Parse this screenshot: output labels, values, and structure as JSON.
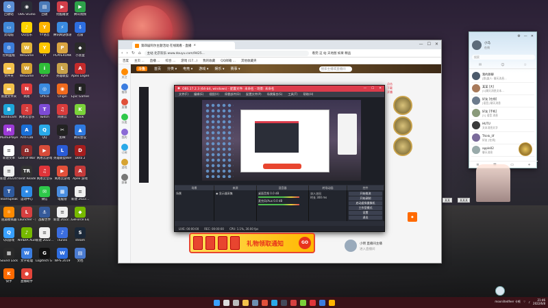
{
  "desktop": {
    "icons": [
      {
        "label": "回收站",
        "color": "#5b8fd6",
        "glyph": "♻"
      },
      {
        "label": "OBS Studio",
        "color": "#2b2e38",
        "glyph": "◉"
      },
      {
        "label": "回收",
        "color": "#4b7ab8",
        "glyph": "▤"
      },
      {
        "label": "优酷播放",
        "color": "#d23f4a",
        "glyph": "▶"
      },
      {
        "label": "腾讯视频",
        "color": "#2ea34a",
        "glyph": "▶"
      },
      {
        "label": "此电脑",
        "color": "#3f87d6",
        "glyph": "▭"
      },
      {
        "label": "QQ音乐",
        "color": "#ffd400",
        "glyph": "♪"
      },
      {
        "label": "YY语音",
        "color": "#ffb400",
        "glyph": "Y"
      },
      {
        "label": "腾讯网游加速",
        "color": "#3a8be0",
        "glyph": "⚡"
      },
      {
        "label": "迅雷",
        "color": "#2d6ee0",
        "glyph": "⇩"
      },
      {
        "label": "控制面板",
        "color": "#3c7dd9",
        "glyph": "⚙"
      },
      {
        "label": "WeGame",
        "color": "#e3b53a",
        "glyph": "W"
      },
      {
        "label": "YY",
        "color": "#ffc500",
        "glyph": "Y"
      },
      {
        "label": "PLAYERUNKNOWN'S BATTLEGR...",
        "color": "#d9a441",
        "glyph": "P"
      },
      {
        "label": "小黑盒",
        "color": "#2a2a2a",
        "glyph": "◆"
      },
      {
        "label": "文件夹",
        "color": "#f3c14b",
        "glyph": "▬"
      },
      {
        "label": "WeGame",
        "color": "#d6a332",
        "glyph": "W"
      },
      {
        "label": "iQIYI",
        "color": "#2fbd38",
        "glyph": "i"
      },
      {
        "label": "英雄联盟",
        "color": "#c9a24a",
        "glyph": "L"
      },
      {
        "label": "Apex Legends",
        "color": "#c52b2b",
        "glyph": "A"
      },
      {
        "label": "新建文件夹",
        "color": "#f3c14b",
        "glyph": "▬"
      },
      {
        "label": "网易",
        "color": "#e03c3c",
        "glyph": "N"
      },
      {
        "label": "Office",
        "color": "#3a8ae0",
        "glyph": "◎"
      },
      {
        "label": "Origin",
        "color": "#f06a1d",
        "glyph": "◉"
      },
      {
        "label": "Epic Games Launcher",
        "color": "#222222",
        "glyph": "E"
      },
      {
        "label": "Bandicam",
        "color": "#1da4d9",
        "glyph": "B"
      },
      {
        "label": "网易云音乐",
        "color": "#d63b3b",
        "glyph": "♫"
      },
      {
        "label": "Twitch",
        "color": "#7d4bd6",
        "glyph": "T"
      },
      {
        "label": "网易云",
        "color": "#d83c3c",
        "glyph": "♫"
      },
      {
        "label": "Kook",
        "color": "#7ad23a",
        "glyph": "K"
      },
      {
        "label": "MumuPlayer",
        "color": "#9c3ad6",
        "glyph": "M"
      },
      {
        "label": "Anti-Lab",
        "color": "#1a6fd6",
        "glyph": "A"
      },
      {
        "label": "QQ",
        "color": "#29a9e8",
        "glyph": "Q"
      },
      {
        "label": "剪映",
        "color": "#222222",
        "glyph": "✂"
      },
      {
        "label": "腾讯会议",
        "color": "#2f7ae0",
        "glyph": "▲"
      },
      {
        "label": "新建文本",
        "color": "#ffffff",
        "glyph": "≡"
      },
      {
        "label": "God of War",
        "color": "#8c2b2b",
        "glyph": "Ω"
      },
      {
        "label": "网易云游戏",
        "color": "#d84c3a",
        "glyph": "▶"
      },
      {
        "label": "英雄联盟WeGame版",
        "color": "#2a5bd6",
        "glyph": "L"
      },
      {
        "label": "Dota 2",
        "color": "#a51d1d",
        "glyph": "D"
      },
      {
        "label": "新建 2022052...",
        "color": "#f0f0f0",
        "glyph": "≡"
      },
      {
        "label": "Tarot Reader",
        "color": "#333333",
        "glyph": "TR"
      },
      {
        "label": "网易云音乐",
        "color": "#e0353a",
        "glyph": "♫"
      },
      {
        "label": "网易云游戏",
        "color": "#e3503a",
        "glyph": "▶"
      },
      {
        "label": "Apex 游戏",
        "color": "#c43a3a",
        "glyph": "A"
      },
      {
        "label": "TeamSpeak",
        "color": "#2f5a9e",
        "glyph": "T"
      },
      {
        "label": "运动中心",
        "color": "#2e8be6",
        "glyph": "★"
      },
      {
        "label": "微信",
        "color": "#2ec84a",
        "glyph": "✉"
      },
      {
        "label": "电脑管",
        "color": "#4a8ee0",
        "glyph": "▦"
      },
      {
        "label": "新建 2022...",
        "color": "#f0f0f0",
        "glyph": "≡"
      },
      {
        "label": "逍遥模拟器",
        "color": "#ff8a00",
        "glyph": "☼"
      },
      {
        "label": "Launcher - 网易",
        "color": "#d64040",
        "glyph": "L"
      },
      {
        "label": "战舰世界",
        "color": "#355a9a",
        "glyph": "⚓"
      },
      {
        "label": "新建 2022...",
        "color": "#f0f0f0",
        "glyph": "≡"
      },
      {
        "label": "GeForce Experience",
        "color": "#76b900",
        "glyph": "◆"
      },
      {
        "label": "QQ游戏",
        "color": "#38a0ff",
        "glyph": "Q"
      },
      {
        "label": "NVIDIA Audio",
        "color": "#76b900",
        "glyph": "♪"
      },
      {
        "label": "新建 2022...",
        "color": "#f0f0f0",
        "glyph": "≡"
      },
      {
        "label": "iTunes",
        "color": "#3b6ee0",
        "glyph": "♪"
      },
      {
        "label": "steam",
        "color": "#1b2838",
        "glyph": "S"
      },
      {
        "label": "Sound Lock",
        "color": "#2a2a2a",
        "glyph": "▦"
      },
      {
        "label": "文字处理",
        "color": "#3b7de0",
        "glyph": "W"
      },
      {
        "label": "Logitech G HUB",
        "color": "#111111",
        "glyph": "G"
      },
      {
        "label": "WPS 2019",
        "color": "#2f6ee0",
        "glyph": "W"
      },
      {
        "label": "文档",
        "color": "#4a7bd0",
        "glyph": "▤"
      },
      {
        "label": "快手",
        "color": "#ff6a00",
        "glyph": "K"
      },
      {
        "label": "直播助手",
        "color": "#e3453a",
        "glyph": "●"
      }
    ]
  },
  "browser": {
    "tab_title": "第四届阿尔主题活动 在线观看 - 直播",
    "url": "主站 北京欢乐 www.douyu.com/9425...",
    "url_search": "看完 这 站 天地图 如果 精品",
    "bookmarks": [
      "百度",
      "主页 ...",
      "直播 ...",
      "综合 ...",
      "游戏 (17...)",
      "我的收藏",
      "QQ邮箱 ...",
      "其他收藏夹"
    ],
    "site_nav": [
      "首页",
      "分类 ▾",
      "电竞 ▾",
      "游戏 ▾",
      "娱乐 ▾",
      "赛事 ▾"
    ],
    "site_logo": "斗鱼",
    "site_search_placeholder": "搜索主播或直播间",
    "sidebar": [
      "关注",
      "推荐",
      "直播",
      "分类",
      "我的",
      "订阅",
      "游戏",
      "赛事"
    ],
    "right_text": [
      "点击",
      "下载",
      "开播"
    ],
    "gift_banner": {
      "text": "礼物领取通知",
      "go": "GO"
    },
    "streamer": {
      "name": "小明 直播间主播",
      "subtitle": "进入直播间"
    }
  },
  "obs": {
    "title": "OBS 27.2.3 (64-bit, windows) - 配置文件: 未命名 - 场景: 未命名",
    "menu": [
      "文件(F)",
      "编辑(E)",
      "视图(V)",
      "停靠部件(D)",
      "配置文件(P)",
      "场景集合(S)",
      "工具(T)",
      "帮助(H)"
    ],
    "docks": [
      "场景",
      "来源",
      "混音器",
      "转场动画",
      "控件"
    ],
    "scenes": [
      "场景"
    ],
    "sources": [
      "显示器采集"
    ],
    "mixer": [
      {
        "name": "桌面音频",
        "level": "0.0 dB"
      },
      {
        "name": "麦克风/Aux",
        "level": "0.0 dB"
      }
    ],
    "transition": {
      "type": "淡入淡出",
      "duration_label": "时长",
      "duration": "300 ms"
    },
    "controls": [
      "开始推流",
      "开始录制",
      "启动虚拟摄像机",
      "工作室模式",
      "设置",
      "退出"
    ],
    "status": [
      "LIVE: 00:00:00",
      "REC: 00:00:00",
      "CPU: 1.1%, 30.00 fps"
    ]
  },
  "qq": {
    "name": "小马",
    "status": "在线",
    "search_placeholder": "搜索",
    "contacts": [
      {
        "name": "我的群聊",
        "msg": "[群]某人: 聊天消息...",
        "color": "#4c5a6a"
      },
      {
        "name": "某某 [大]",
        "msg": "[1]聊天消息文本...",
        "color": "#a87a5a"
      },
      {
        "name": "好友 [在线]",
        "msg": "[语音] 聊天消息",
        "color": "#6c7a8c"
      },
      {
        "name": "好友 [手机]",
        "msg": "[1] 语音 消息",
        "color": "#8a9a7a"
      },
      {
        "name": "HUTU",
        "msg": "文本消息文字",
        "color": "#3a3a3a"
      },
      {
        "name": "Think_lif",
        "msg": "好友 [在线]",
        "color": "#7a6a9a"
      },
      {
        "name": "apple02",
        "msg": "聊天消息",
        "color": "#9aa"
      }
    ],
    "small_tabs": [
      "某某",
      "某某某"
    ]
  },
  "taskbar": {
    "icons": [
      {
        "name": "windows-start",
        "color": "#3aa0ff"
      },
      {
        "name": "search",
        "color": "#dddddd"
      },
      {
        "name": "task-view",
        "color": "#bbbbbb"
      },
      {
        "name": "file-explorer",
        "color": "#f3c14b"
      },
      {
        "name": "steam",
        "color": "#6d8fb0"
      },
      {
        "name": "browser",
        "color": "#e0503a"
      },
      {
        "name": "qq",
        "color": "#29a9e8"
      },
      {
        "name": "obs",
        "color": "#444a5a"
      },
      {
        "name": "game",
        "color": "#d64040"
      },
      {
        "name": "app",
        "color": "#7ad23a"
      },
      {
        "name": "music",
        "color": "#e0353a"
      },
      {
        "name": "store",
        "color": "#3b7de0"
      },
      {
        "name": "mail",
        "color": "#ffb400"
      }
    ],
    "tray_text": "moonlitedfeer 卡顿",
    "time": "21:46",
    "date": "2022/6/8"
  }
}
